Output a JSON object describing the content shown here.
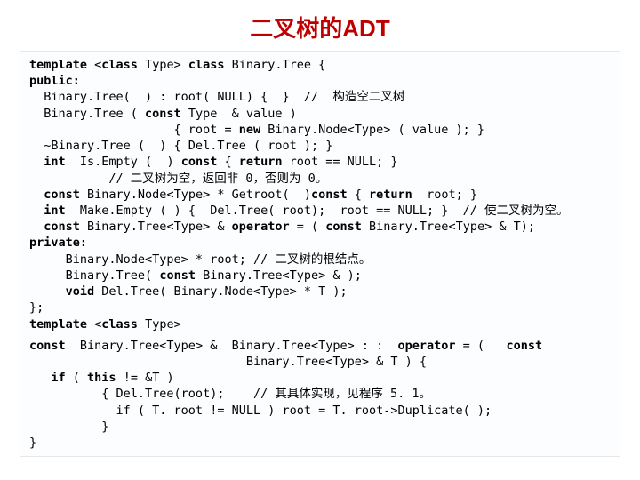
{
  "title": "二叉树的ADT",
  "code": {
    "l1a": "template",
    "l1b": " <",
    "l1c": "class",
    "l1d": " Type> ",
    "l1e": "class",
    "l1f": " Binary.Tree {",
    "l2": "public:",
    "l3": "  Binary.Tree(  ) : root( NULL) {  }  //  构造空二叉树",
    "l4a": "  Binary.Tree ( ",
    "l4b": "const",
    "l4c": " Type  & value )",
    "l5a": "                    { root = ",
    "l5b": "new",
    "l5c": " Binary.Node<Type> ( value ); }",
    "l6": "  ~Binary.Tree (  ) { Del.Tree ( root ); }",
    "l7a": "  ",
    "l7b": "int",
    "l7c": "  Is.Empty (  ) ",
    "l7d": "const",
    "l7e": " { ",
    "l7f": "return",
    "l7g": " root == NULL; }",
    "l8": "           // 二叉树为空，返回非 0，否则为 0。",
    "l9a": "  ",
    "l9b": "const",
    "l9c": " Binary.Node<Type> * Getroot(  )",
    "l9d": "const",
    "l9e": " { ",
    "l9f": "return",
    "l9g": "  root; }",
    "l10a": "  ",
    "l10b": "int",
    "l10c": "  Make.Empty ( ) {  Del.Tree( root);  root == NULL; }  // 使二叉树为空。",
    "l11a": "  ",
    "l11b": "const",
    "l11c": " Binary.Tree<Type> & ",
    "l11d": "operator",
    "l11e": " = ( ",
    "l11f": "const",
    "l11g": " Binary.Tree<Type> & T);",
    "l12": "private:",
    "l13": "     Binary.Node<Type> * root; // 二叉树的根结点。",
    "l14a": "     Binary.Tree( ",
    "l14b": "const",
    "l14c": " Binary.Tree<Type> & );",
    "l15a": "     ",
    "l15b": "void",
    "l15c": " Del.Tree( Binary.Node<Type> * T );",
    "l16": "};",
    "l17a": "template",
    "l17b": " <",
    "l17c": "class",
    "l17d": " Type>",
    "l18a": "const",
    "l18b": "  Binary.Tree<Type> &  Binary.Tree<Type> : :  ",
    "l18c": "operator",
    "l18d": " = (   ",
    "l18e": "const",
    "l19": "                              Binary.Tree<Type> & T ) {",
    "l20a": "   ",
    "l20b": "if",
    "l20c": " ( ",
    "l20d": "this",
    "l20e": " != &T )",
    "l21": "          { Del.Tree(root);    // 其具体实现，见程序 5. 1。",
    "l22": "            if ( T. root != NULL ) root = T. root->Duplicate( );",
    "l23": "          }",
    "l24": "}"
  }
}
